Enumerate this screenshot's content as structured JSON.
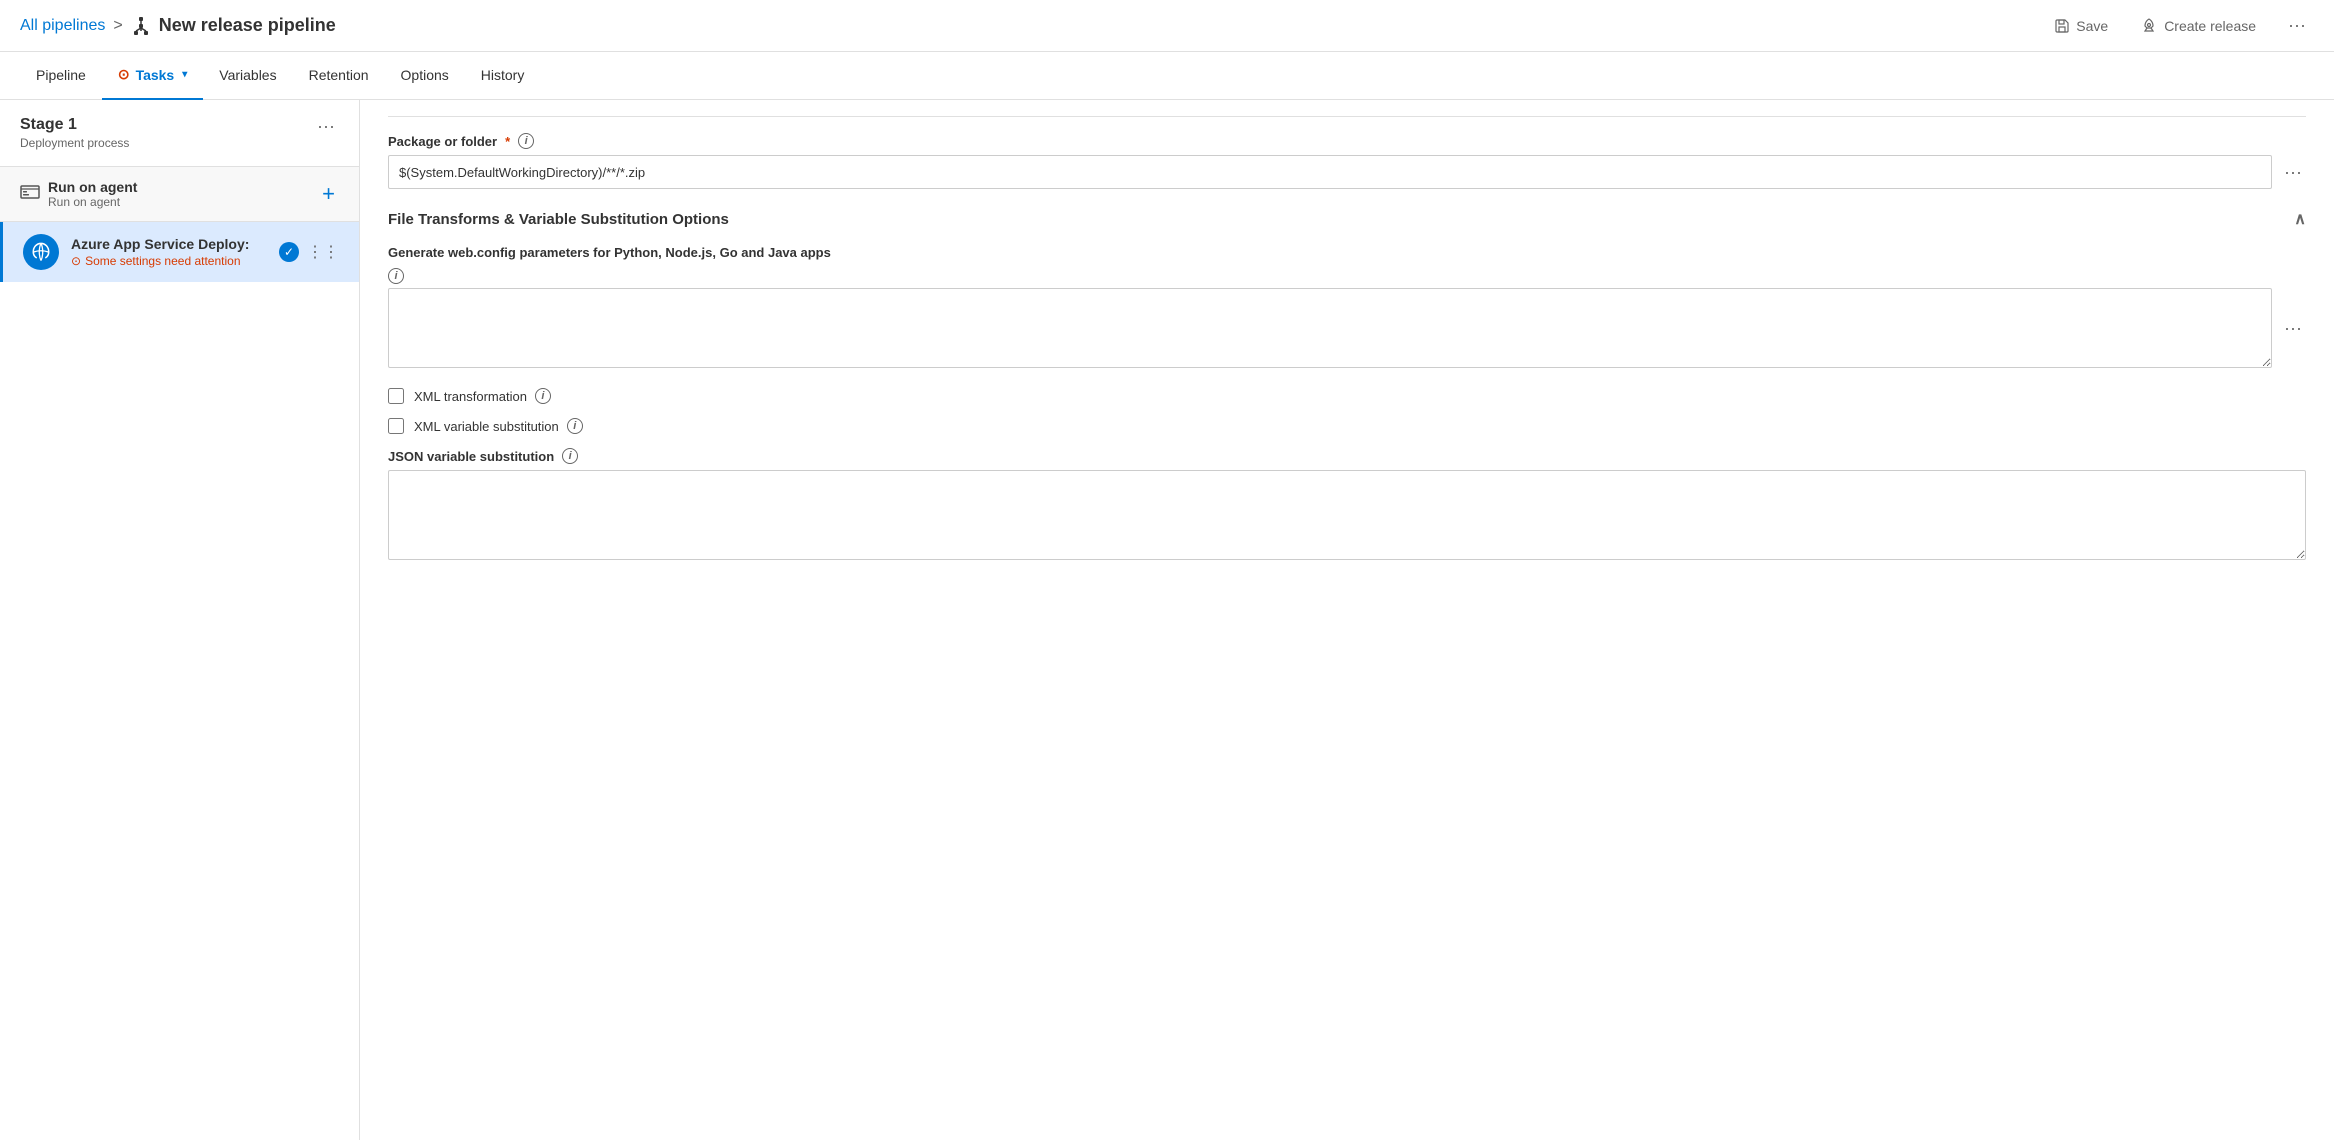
{
  "header": {
    "breadcrumb": "All pipelines",
    "separator": ">",
    "title": "New release pipeline",
    "save_label": "Save",
    "create_release_label": "Create release",
    "more": "..."
  },
  "nav": {
    "tabs": [
      {
        "id": "pipeline",
        "label": "Pipeline",
        "active": false,
        "warning": false
      },
      {
        "id": "tasks",
        "label": "Tasks",
        "active": true,
        "warning": true
      },
      {
        "id": "variables",
        "label": "Variables",
        "active": false,
        "warning": false
      },
      {
        "id": "retention",
        "label": "Retention",
        "active": false,
        "warning": false
      },
      {
        "id": "options",
        "label": "Options",
        "active": false,
        "warning": false
      },
      {
        "id": "history",
        "label": "History",
        "active": false,
        "warning": false
      }
    ]
  },
  "left_panel": {
    "stage_title": "Stage 1",
    "stage_subtitle": "Deployment process",
    "run_on_agent_title": "Run on agent",
    "run_on_agent_subtitle": "Run on agent",
    "task_title": "Azure App Service Deploy:",
    "task_warning": "Some settings need attention"
  },
  "right_panel": {
    "package_label": "Package or folder",
    "package_value": "$(System.DefaultWorkingDirectory)/**/*.zip",
    "file_transforms_title": "File Transforms & Variable Substitution Options",
    "generate_webconfig_label": "Generate web.config parameters for Python, Node.js, Go and Java apps",
    "xml_transformation_label": "XML transformation",
    "xml_variable_substitution_label": "XML variable substitution",
    "json_variable_substitution_label": "JSON variable substitution"
  }
}
